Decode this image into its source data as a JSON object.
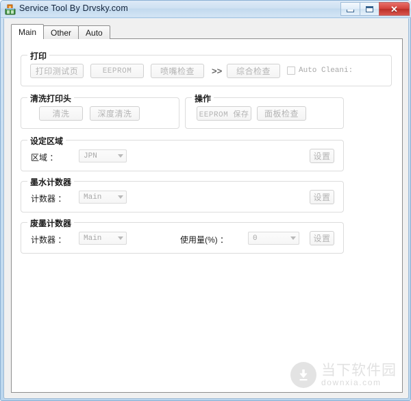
{
  "window": {
    "title": "Service Tool By Drvsky.com",
    "icon": "printer-app-icon",
    "buttons": {
      "minimize": "minimize-icon",
      "maximize": "maximize-icon",
      "close": "✕"
    }
  },
  "tabs": [
    {
      "label": "Main",
      "active": true
    },
    {
      "label": "Other",
      "active": false
    },
    {
      "label": "Auto",
      "active": false
    }
  ],
  "groups": {
    "print": {
      "title": "打印",
      "buttons": [
        {
          "label": "打印测试页"
        },
        {
          "label": "EEPROM"
        },
        {
          "label": "喷嘴检查"
        },
        {
          "label": "综合检查"
        }
      ],
      "separator": ">>",
      "checkbox": {
        "label": "Auto Cleani:",
        "checked": false
      }
    },
    "clean_head": {
      "title": "清洗打印头",
      "buttons": [
        {
          "label": "清洗"
        },
        {
          "label": "深度清洗"
        }
      ]
    },
    "operation": {
      "title": "操作",
      "buttons": [
        {
          "label": "EEPROM 保存"
        },
        {
          "label": "面板检查"
        }
      ]
    },
    "region": {
      "title": "设定区域",
      "field_label": "区域 ：",
      "combo_value": "JPN",
      "set_button": "设置"
    },
    "ink_counter": {
      "title": "墨水计数器",
      "field_label": "计数器 ：",
      "combo_value": "Main",
      "set_button": "设置"
    },
    "waste_ink_counter": {
      "title": "废墨计数器",
      "field_label": "计数器 ：",
      "combo_value": "Main",
      "usage_label": "使用量(%) ：",
      "usage_value": "0",
      "set_button": "设置"
    }
  },
  "watermark": {
    "icon": "download-arrow-icon",
    "title": "当下软件园",
    "subtitle": "downxia.com"
  },
  "colors": {
    "titlebar_accent": "#cfe1f2",
    "close_button": "#d4433c",
    "frame_border": "#8ab0d4",
    "disabled_text": "#b4b4b4"
  }
}
